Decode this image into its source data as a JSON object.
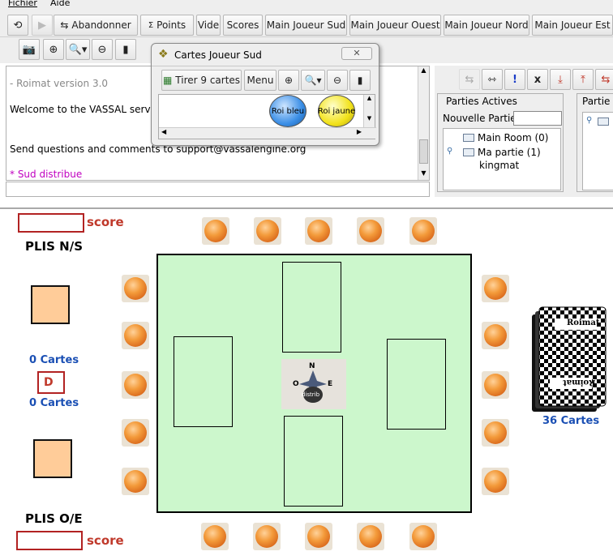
{
  "menu": {
    "items": [
      "Fichier",
      "Aide"
    ]
  },
  "toolbar": {
    "abandon": "Abandonner",
    "points": "Points",
    "vide": "Vide",
    "scores": "Scores",
    "hand_sud": "Main Joueur Sud",
    "hand_ouest": "Main Joueur Ouest",
    "hand_nord": "Main Joueur Nord",
    "hand_est": "Main Joueur Est"
  },
  "chat": {
    "lines": [
      "- Roimat version 3.0",
      "Welcome to the VASSAL server",
      "Send questions and comments to support@vassalengine.org",
      "* Sud distribue"
    ],
    "input_value": ""
  },
  "server": {
    "active_label": "Parties Actives",
    "other_label": "Partie d",
    "new_game_label": "Nouvelle Partie:",
    "new_game_value": "",
    "tree": [
      {
        "label": "Main Room (0)",
        "type": "room"
      },
      {
        "label": "Ma partie (1)",
        "type": "room"
      },
      {
        "label": "kingmat",
        "type": "player"
      }
    ]
  },
  "dialog": {
    "title": "Cartes Joueur Sud",
    "draw_button": "Tirer 9 cartes",
    "menu_button": "Menu",
    "pieces": [
      {
        "label": "Roi bleu",
        "color": "#3a8ee6"
      },
      {
        "label": "Roi jaune",
        "color": "#f2e21a"
      }
    ]
  },
  "board": {
    "score_label": "score",
    "plis_ns": "PLIS N/S",
    "plis_oe": "PLIS O/E",
    "cartes_ns": "0 Cartes",
    "cartes_oe": "0 Cartes",
    "dealer_marker": "D",
    "deck_count": "36 Cartes",
    "deck_logo": "Roimat",
    "compass": {
      "n": "N",
      "o": "O",
      "e": "E",
      "label": "distrib"
    }
  },
  "colors": {
    "table_green": "#ccf7cc",
    "score_red": "#c0392b",
    "cartes_blue": "#1a4fb4",
    "peach": "#ffcc99"
  }
}
